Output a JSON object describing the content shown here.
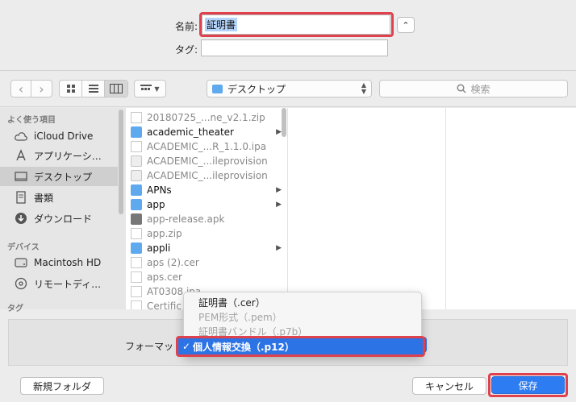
{
  "save_form": {
    "name_label": "名前:",
    "name_value": "証明書",
    "tag_label": "タグ:",
    "tag_value": "",
    "expand_glyph": "⌃"
  },
  "toolbar": {
    "back_glyph": "‹",
    "forward_glyph": "›",
    "location": "デスクトップ",
    "search_placeholder": "検索"
  },
  "sidebar": {
    "favorites_header": "よく使う項目",
    "favorites": [
      {
        "label": "iCloud Drive",
        "icon": "cloud-icon"
      },
      {
        "label": "アプリケーシ…",
        "icon": "applications-icon"
      },
      {
        "label": "デスクトップ",
        "icon": "desktop-icon",
        "active": true
      },
      {
        "label": "書類",
        "icon": "documents-icon"
      },
      {
        "label": "ダウンロード",
        "icon": "downloads-icon"
      }
    ],
    "devices_header": "デバイス",
    "devices": [
      {
        "label": "Macintosh HD",
        "icon": "harddisk-icon"
      },
      {
        "label": "リモートディ…",
        "icon": "remote-disc-icon"
      }
    ],
    "tags_header": "タグ"
  },
  "files": [
    {
      "name": "20180725_...ne_v2.1.zip",
      "kind": "zip",
      "folder": false
    },
    {
      "name": "academic_theater",
      "kind": "folder",
      "folder": true
    },
    {
      "name": "ACADEMIC_...R_1.1.0.ipa",
      "kind": "file",
      "folder": false
    },
    {
      "name": "ACADEMIC_...ileprovision",
      "kind": "prov",
      "folder": false
    },
    {
      "name": "ACADEMIC_...ileprovision",
      "kind": "prov",
      "folder": false
    },
    {
      "name": "APNs",
      "kind": "folder",
      "folder": true
    },
    {
      "name": "app",
      "kind": "folder",
      "folder": true
    },
    {
      "name": "app-release.apk",
      "kind": "pkg",
      "folder": false
    },
    {
      "name": "app.zip",
      "kind": "zip",
      "folder": false
    },
    {
      "name": "appli",
      "kind": "folder",
      "folder": true
    },
    {
      "name": "aps (2).cer",
      "kind": "file",
      "folder": false
    },
    {
      "name": "aps.cer",
      "kind": "file",
      "folder": false
    },
    {
      "name": "AT0308.ipa",
      "kind": "file",
      "folder": false
    },
    {
      "name": "Certific",
      "kind": "file",
      "folder": false
    }
  ],
  "format": {
    "label": "フォーマット",
    "options": [
      {
        "label": "証明書（.cer）",
        "state": "enabled"
      },
      {
        "label": "PEM形式（.pem）",
        "state": "disabled"
      },
      {
        "label": "証明書バンドル（.p7b）",
        "state": "disabled"
      },
      {
        "label": "個人情報交換（.p12）",
        "state": "selected",
        "check": "✓"
      }
    ]
  },
  "buttons": {
    "new_folder": "新規フォルダ",
    "cancel": "キャンセル",
    "save": "保存"
  },
  "colors": {
    "accent": "#2d7cf2",
    "highlight_border": "#e0424d",
    "selection_bg": "#b5d4fb"
  }
}
